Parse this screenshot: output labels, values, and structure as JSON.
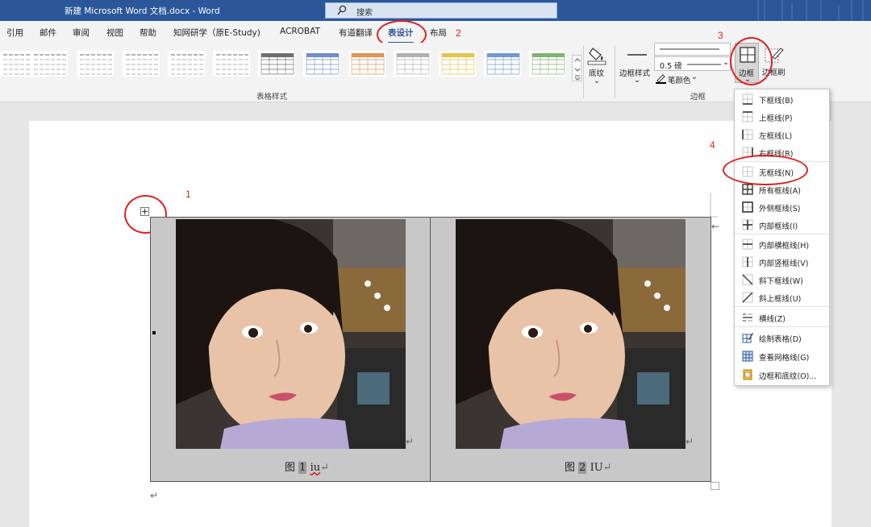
{
  "titlebar": {
    "title": "新建 Microsoft Word 文档.docx  -  Word",
    "search_placeholder": "搜索"
  },
  "tabs": [
    {
      "label": "引用"
    },
    {
      "label": "邮件"
    },
    {
      "label": "审阅"
    },
    {
      "label": "视图"
    },
    {
      "label": "帮助"
    },
    {
      "label": "知网研学（原E-Study)"
    },
    {
      "label": "ACROBAT"
    },
    {
      "label": "有道翻译"
    },
    {
      "label": "表设计",
      "active": true
    },
    {
      "label": "布局"
    }
  ],
  "ribbon": {
    "table_styles_label": "表格样式",
    "shading_label": "底纹",
    "border_styles_label": "边框样式",
    "line_weight": "0.5 磅",
    "pen_color_label": "笔颜色",
    "borders_button_label": "边框",
    "border_painter_label": "边框刷",
    "borders_group_label": "边框"
  },
  "annotations": {
    "n1": "1",
    "n2": "2",
    "n3": "3",
    "n4": "4"
  },
  "document": {
    "caption1_prefix": "图",
    "caption1_num": "1",
    "caption1_text": "iu",
    "caption2_prefix": "图",
    "caption2_num": "2",
    "caption2_text": "IU",
    "para_mark": "↵"
  },
  "border_menu": {
    "items": [
      {
        "label": "下框线(B)",
        "icon": "bottom-border-icon"
      },
      {
        "label": "上框线(P)",
        "icon": "top-border-icon"
      },
      {
        "label": "左框线(L)",
        "icon": "left-border-icon"
      },
      {
        "label": "右框线(R)",
        "icon": "right-border-icon"
      },
      {
        "label": "无框线(N)",
        "icon": "no-border-icon"
      },
      {
        "label": "所有框线(A)",
        "icon": "all-borders-icon"
      },
      {
        "label": "外侧框线(S)",
        "icon": "outside-borders-icon"
      },
      {
        "label": "内部框线(I)",
        "icon": "inside-borders-icon"
      },
      {
        "label": "内部横框线(H)",
        "icon": "inside-horizontal-border-icon"
      },
      {
        "label": "内部竖框线(V)",
        "icon": "inside-vertical-border-icon"
      },
      {
        "label": "斜下框线(W)",
        "icon": "diagonal-down-border-icon"
      },
      {
        "label": "斜上框线(U)",
        "icon": "diagonal-up-border-icon"
      },
      {
        "label": "横线(Z)",
        "icon": "horizontal-line-icon"
      },
      {
        "label": "绘制表格(D)",
        "icon": "draw-table-icon"
      },
      {
        "label": "查看网格线(G)",
        "icon": "view-gridlines-icon"
      },
      {
        "label": "边框和底纹(O)...",
        "icon": "borders-and-shading-icon"
      }
    ]
  },
  "colors": {
    "titlebar": "#2b579a",
    "accent": "#2b579a",
    "annotation_red": "#e01f1f"
  }
}
